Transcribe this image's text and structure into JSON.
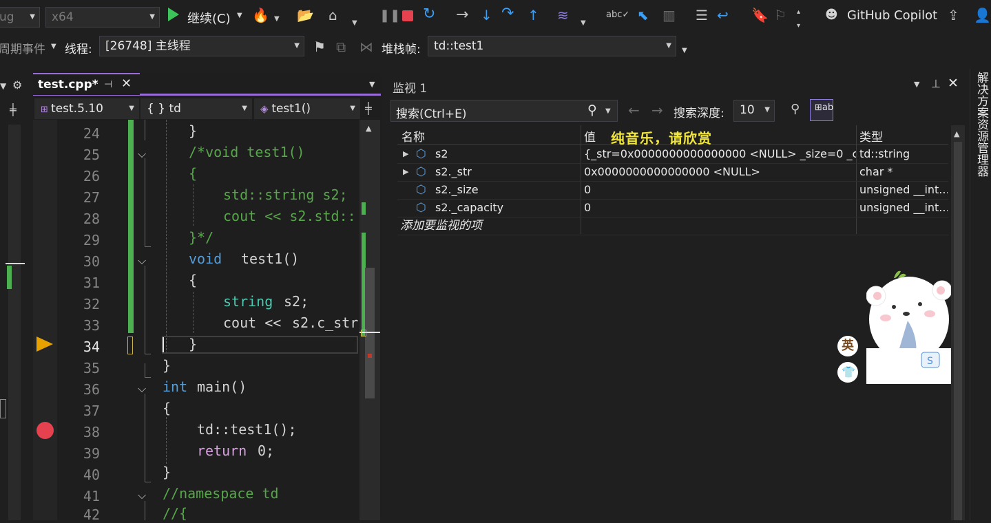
{
  "toolbar": {
    "config_combo": "ug",
    "platform_combo": "x64",
    "continue_label": "继续(C)",
    "copilot_label": "GitHub Copilot"
  },
  "debug_bar": {
    "lifecycle_label": "周期事件",
    "thread_label": "线程:",
    "thread_value": "[26748] 主线程",
    "stackframe_label": "堆栈帧:",
    "stackframe_value": "td::test1"
  },
  "editor": {
    "tab_title": "test.cpp*",
    "project_combo": "test.5.10",
    "scope_combo": "{ } td",
    "function_combo": "test1()",
    "line_numbers": [
      "24",
      "25",
      "26",
      "27",
      "28",
      "29",
      "30",
      "31",
      "32",
      "33",
      "34",
      "35",
      "36",
      "37",
      "38",
      "39",
      "40",
      "41",
      "42"
    ],
    "current_line": "34",
    "breakpoint_line": "38"
  },
  "code_lines": {
    "l24": "}",
    "l25": "/*void test1()",
    "l26": "{",
    "l27a": "std::string s2;",
    "l28a": "cout << s2.std::",
    "l29": "}*/",
    "l30a": "void",
    "l30b": "test1()",
    "l31": "{",
    "l32a": "string",
    "l32b": "s2;",
    "l33a": "cout << ",
    "l33b": "s2.c_str",
    "l34": "}",
    "l35": "}",
    "l36a": "int",
    "l36b": "main()",
    "l37": "{",
    "l38": "td::test1();",
    "l39a": "return",
    "l39b": "0;",
    "l40": "}",
    "l41": "//namespace td",
    "l42": "//{"
  },
  "watch": {
    "title": "监视 1",
    "search_placeholder": "搜索(Ctrl+E)",
    "depth_label": "搜索深度:",
    "depth_value": "10",
    "col_name": "名称",
    "col_value": "值",
    "col_type": "类型",
    "overlay_text": "纯音乐，请欣赏",
    "rows": [
      {
        "name": "s2",
        "value": "{_str=0x0000000000000000 <NULL> _size=0 _c...",
        "type": "td::string"
      },
      {
        "name": "s2._str",
        "value": "0x0000000000000000 <NULL>",
        "type": "char *"
      },
      {
        "name": "s2._size",
        "value": "0",
        "type": "unsigned __int..."
      },
      {
        "name": "s2._capacity",
        "value": "0",
        "type": "unsigned __int..."
      }
    ],
    "add_item": "添加要监视的项"
  },
  "side_panel": {
    "solution_explorer": "解决方案资源管理器"
  },
  "sticker": {
    "char": "英"
  }
}
